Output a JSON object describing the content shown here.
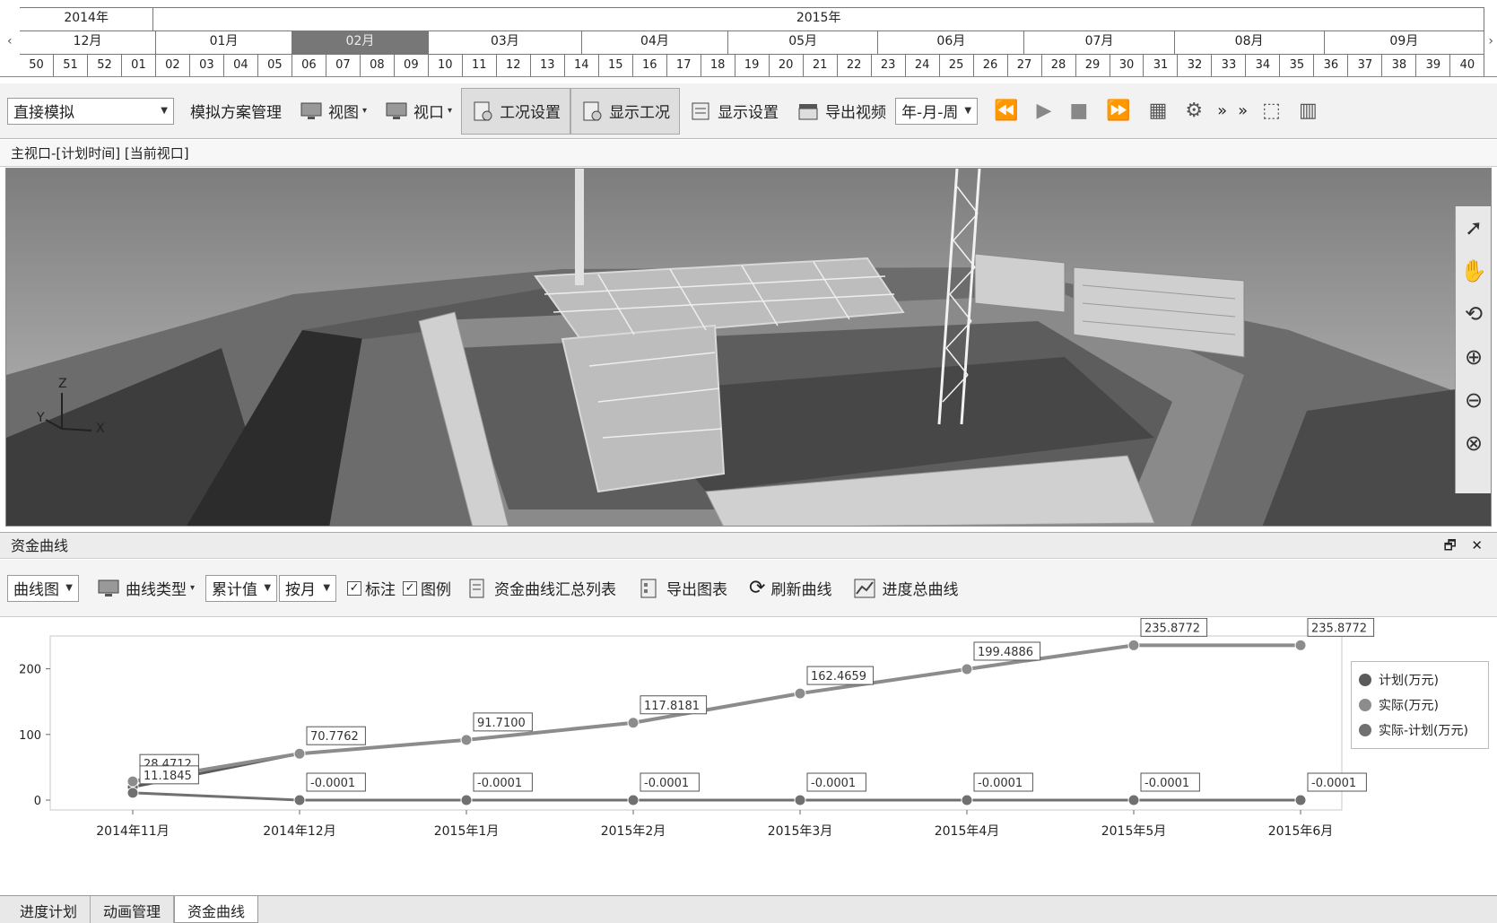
{
  "timeline": {
    "years": [
      {
        "label": "2014年",
        "weeks": 4
      },
      {
        "label": "2015年",
        "weeks": 40
      }
    ],
    "months": [
      {
        "label": "12月",
        "weeks": 4
      },
      {
        "label": "01月",
        "weeks": 4
      },
      {
        "label": "02月",
        "weeks": 4,
        "selected": true
      },
      {
        "label": "03月",
        "weeks": 4.5
      },
      {
        "label": "04月",
        "weeks": 4.3
      },
      {
        "label": "05月",
        "weeks": 4.4
      },
      {
        "label": "06月",
        "weeks": 4.3
      },
      {
        "label": "07月",
        "weeks": 4.4
      },
      {
        "label": "08月",
        "weeks": 4.4
      },
      {
        "label": "09月",
        "weeks": 4.7
      }
    ],
    "weeks": [
      "50",
      "51",
      "52",
      "01",
      "02",
      "03",
      "04",
      "05",
      "06",
      "07",
      "08",
      "09",
      "10",
      "11",
      "12",
      "13",
      "14",
      "15",
      "16",
      "17",
      "18",
      "19",
      "20",
      "21",
      "22",
      "23",
      "24",
      "25",
      "26",
      "27",
      "28",
      "29",
      "30",
      "31",
      "32",
      "33",
      "34",
      "35",
      "36",
      "37",
      "38",
      "39",
      "40"
    ],
    "left_arrow": "‹",
    "right_arrow": "›"
  },
  "toolbar": {
    "sim_mode": "直接模拟",
    "scheme_mgmt": "模拟方案管理",
    "view": "视图",
    "viewport": "视口",
    "work_settings": "工况设置",
    "show_work": "显示工况",
    "display_settings": "显示设置",
    "export_video": "导出视频",
    "time_unit": "年-月-周",
    "more1": "»",
    "more2": "»"
  },
  "viewport": {
    "title": "主视口-[计划时间] [当前视口]",
    "axis_z": "Z",
    "axis_y": "Y",
    "axis_x": "X"
  },
  "funds": {
    "panel_title": "资金曲线",
    "win_buttons": "🗗 ✕",
    "chart_mode": "曲线图",
    "curve_type": "曲线类型",
    "value_mode": "累计值",
    "period": "按月",
    "annotate_label": "标注",
    "legend_label": "图例",
    "summary_table": "资金曲线汇总列表",
    "export_chart": "导出图表",
    "refresh_curve": "刷新曲线",
    "progress_curve": "进度总曲线"
  },
  "chart_data": {
    "type": "line",
    "categories": [
      "2014年11月",
      "2014年12月",
      "2015年1月",
      "2015年2月",
      "2015年3月",
      "2015年4月",
      "2015年5月",
      "2015年6月"
    ],
    "ylim": [
      -15,
      250
    ],
    "yticks": [
      0,
      100,
      200
    ],
    "series": [
      {
        "name": "计划(万元)",
        "color": "#5b5b5b",
        "values": [
          20,
          70.7762,
          91.71,
          117.8181,
          162.4659,
          199.4886,
          235.8772,
          235.8772
        ],
        "show_labels": false
      },
      {
        "name": "实际(万元)",
        "color": "#8c8c8c",
        "values": [
          28.4712,
          70.7762,
          91.71,
          117.8181,
          162.4659,
          199.4886,
          235.8772,
          235.8772
        ],
        "labels": [
          "28.4712",
          "70.7762",
          "91.7100",
          "117.8181",
          "162.4659",
          "199.4886",
          "235.8772",
          "235.8772"
        ]
      },
      {
        "name": "实际-计划(万元)",
        "color": "#707070",
        "values": [
          11.1845,
          -0.0001,
          -0.0001,
          -0.0001,
          -0.0001,
          -0.0001,
          -0.0001,
          -0.0001
        ],
        "labels": [
          "11.1845",
          "-0.0001",
          "-0.0001",
          "-0.0001",
          "-0.0001",
          "-0.0001",
          "-0.0001",
          "-0.0001"
        ]
      }
    ]
  },
  "bottom_tabs": [
    "进度计划",
    "动画管理",
    "资金曲线"
  ],
  "active_tab": 2
}
